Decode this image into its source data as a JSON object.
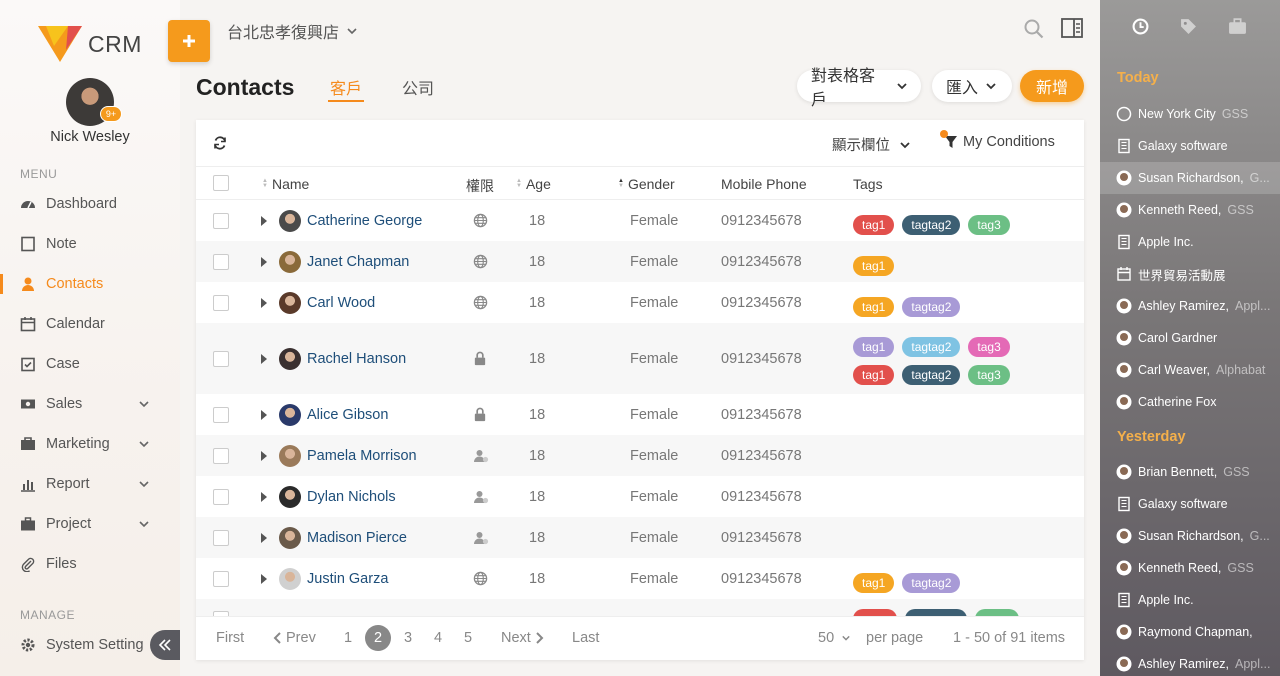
{
  "app": {
    "brand": "CRM",
    "store": "台北忠孝復興店"
  },
  "user": {
    "name": "Nick Wesley",
    "badge": "9+"
  },
  "menu_label": "MENU",
  "manage_label": "MANAGE",
  "nav": [
    {
      "label": "Dashboard",
      "icon": "dashboard-icon"
    },
    {
      "label": "Note",
      "icon": "note-icon"
    },
    {
      "label": "Contacts",
      "icon": "contacts-icon",
      "active": true
    },
    {
      "label": "Calendar",
      "icon": "calendar-icon"
    },
    {
      "label": "Case",
      "icon": "case-icon"
    },
    {
      "label": "Sales",
      "icon": "sales-icon",
      "expand": true
    },
    {
      "label": "Marketing",
      "icon": "marketing-icon",
      "expand": true
    },
    {
      "label": "Report",
      "icon": "report-icon",
      "expand": true
    },
    {
      "label": "Project",
      "icon": "project-icon",
      "expand": true
    },
    {
      "label": "Files",
      "icon": "files-icon"
    }
  ],
  "system_setting": "System Setting",
  "page": {
    "title": "Contacts",
    "tabs": [
      "客戶",
      "公司"
    ],
    "actions": {
      "table_customers": "對表格客戶",
      "import": "匯入",
      "new": "新增"
    }
  },
  "table": {
    "columns_toggle": "顯示欄位",
    "conditions": "My Conditions",
    "headers": {
      "name": "Name",
      "perm": "權限",
      "age": "Age",
      "gender": "Gender",
      "phone": "Mobile Phone",
      "tags": "Tags"
    },
    "rows": [
      {
        "name": "Catherine George",
        "perm": "globe-icon",
        "age": "18",
        "gender": "Female",
        "phone": "0912345678",
        "tags": [
          [
            "tag1",
            "t1r"
          ],
          [
            "tagtag2",
            "t2d"
          ],
          [
            "tag3",
            "t3g"
          ]
        ],
        "avatar": "#4a4a4a"
      },
      {
        "name": "Janet Chapman",
        "perm": "globe-icon",
        "age": "18",
        "gender": "Female",
        "phone": "0912345678",
        "tags": [
          [
            "tag1",
            "t1o"
          ]
        ],
        "avatar": "#8a6a3a"
      },
      {
        "name": "Carl Wood",
        "perm": "globe-icon",
        "age": "18",
        "gender": "Female",
        "phone": "0912345678",
        "tags": [
          [
            "tag1",
            "t1o"
          ],
          [
            "tagtag2",
            "t2p"
          ]
        ],
        "avatar": "#5a3a2a"
      },
      {
        "name": "Rachel Hanson",
        "perm": "lock-icon",
        "age": "18",
        "gender": "Female",
        "phone": "0912345678",
        "tags": [
          [
            "tag1",
            "t2p"
          ],
          [
            "tagtag2",
            "t2b"
          ],
          [
            "tag3",
            "t3p"
          ],
          [
            "tag1",
            "t1r"
          ],
          [
            "tagtag2",
            "t2d"
          ],
          [
            "tag3",
            "t3g"
          ]
        ],
        "avatar": "#3a3030"
      },
      {
        "name": "Alice Gibson",
        "perm": "lock-icon",
        "age": "18",
        "gender": "Female",
        "phone": "0912345678",
        "tags": [],
        "avatar": "#2a3a6a"
      },
      {
        "name": "Pamela Morrison",
        "perm": "user-share-icon",
        "age": "18",
        "gender": "Female",
        "phone": "0912345678",
        "tags": [],
        "avatar": "#9a7a5a"
      },
      {
        "name": "Dylan Nichols",
        "perm": "user-share-icon",
        "age": "18",
        "gender": "Female",
        "phone": "0912345678",
        "tags": [],
        "avatar": "#2a2a2a"
      },
      {
        "name": "Madison Pierce",
        "perm": "user-share-icon",
        "age": "18",
        "gender": "Female",
        "phone": "0912345678",
        "tags": [],
        "avatar": "#6a5a4a"
      },
      {
        "name": "Justin Garza",
        "perm": "globe-icon",
        "age": "18",
        "gender": "Female",
        "phone": "0912345678",
        "tags": [
          [
            "tag1",
            "t1o"
          ],
          [
            "tagtag2",
            "t2p"
          ]
        ],
        "avatar": "#d0d0d0"
      }
    ]
  },
  "pager": {
    "first": "First",
    "prev": "Prev",
    "pages": [
      "1",
      "2",
      "3",
      "4",
      "5"
    ],
    "current": "2",
    "next": "Next",
    "last": "Last",
    "per_page_value": "50",
    "per_page_label": "per page",
    "summary": "1 - 50 of 91 items"
  },
  "right_panel": {
    "today_label": "Today",
    "yesterday_label": "Yesterday",
    "today": [
      {
        "label": "New York City",
        "sub": "GSS",
        "icon": "circle-icon"
      },
      {
        "label": "Galaxy software",
        "sub": "",
        "icon": "building-icon"
      },
      {
        "label": "Susan Richardson,",
        "sub": "G...",
        "icon": "person-icon",
        "highlight": true
      },
      {
        "label": "Kenneth Reed,",
        "sub": "GSS",
        "icon": "person-icon"
      },
      {
        "label": "Apple Inc.",
        "sub": "",
        "icon": "building-icon"
      },
      {
        "label": "世界貿易活動展",
        "sub": "",
        "icon": "calendar-icon"
      },
      {
        "label": "Ashley Ramirez,",
        "sub": "Appl...",
        "icon": "person-icon"
      },
      {
        "label": "Carol Gardner",
        "sub": "",
        "icon": "person-icon"
      },
      {
        "label": "Carl Weaver,",
        "sub": "Alphabat",
        "icon": "person-icon"
      },
      {
        "label": "Catherine Fox",
        "sub": "",
        "icon": "person-icon"
      }
    ],
    "yesterday": [
      {
        "label": "Brian Bennett,",
        "sub": "GSS",
        "icon": "person-icon"
      },
      {
        "label": "Galaxy software",
        "sub": "",
        "icon": "building-icon"
      },
      {
        "label": "Susan Richardson,",
        "sub": "G...",
        "icon": "person-icon"
      },
      {
        "label": "Kenneth Reed,",
        "sub": "GSS",
        "icon": "person-icon"
      },
      {
        "label": "Apple Inc.",
        "sub": "",
        "icon": "building-icon"
      },
      {
        "label": "Raymond Chapman,",
        "sub": "",
        "icon": "person-icon"
      },
      {
        "label": "Ashley Ramirez,",
        "sub": "Appl...",
        "icon": "person-icon"
      }
    ]
  },
  "colors": {
    "accent": "#f59a1c",
    "link": "#1e4e79",
    "panel_heading": "#f5b04a"
  }
}
